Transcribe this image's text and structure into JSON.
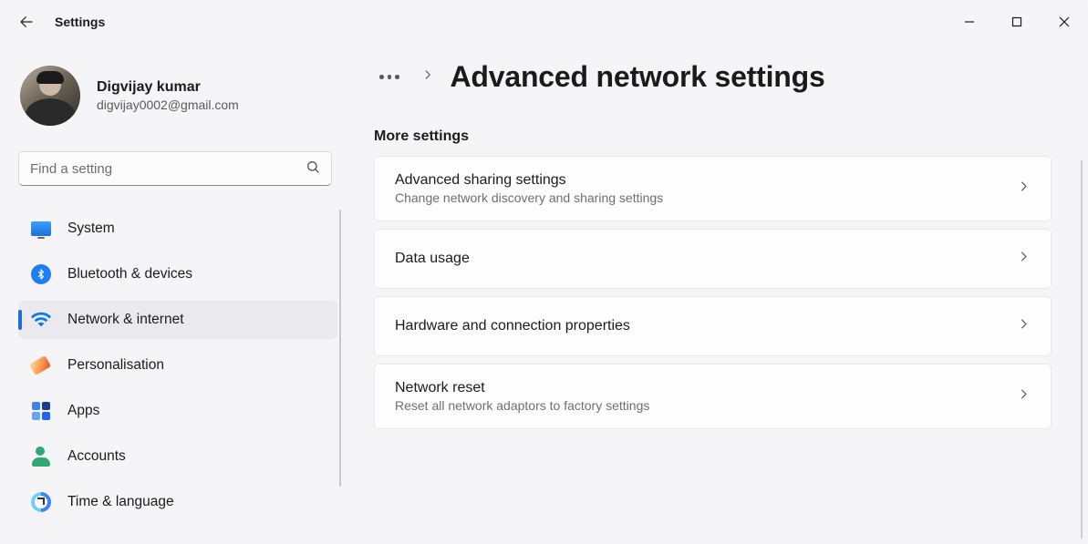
{
  "app_title": "Settings",
  "profile": {
    "name": "Digvijay kumar",
    "email": "digvijay0002@gmail.com"
  },
  "search": {
    "placeholder": "Find a setting"
  },
  "sidebar": {
    "items": [
      {
        "label": "System",
        "icon": "system-icon",
        "active": false
      },
      {
        "label": "Bluetooth & devices",
        "icon": "bluetooth-icon",
        "active": false
      },
      {
        "label": "Network & internet",
        "icon": "network-icon",
        "active": true
      },
      {
        "label": "Personalisation",
        "icon": "personalisation-icon",
        "active": false
      },
      {
        "label": "Apps",
        "icon": "apps-icon",
        "active": false
      },
      {
        "label": "Accounts",
        "icon": "accounts-icon",
        "active": false
      },
      {
        "label": "Time & language",
        "icon": "time-language-icon",
        "active": false
      }
    ]
  },
  "breadcrumb": {
    "page_title": "Advanced network settings"
  },
  "section_label": "More settings",
  "cards": [
    {
      "title": "Advanced sharing settings",
      "subtitle": "Change network discovery and sharing settings"
    },
    {
      "title": "Data usage",
      "subtitle": ""
    },
    {
      "title": "Hardware and connection properties",
      "subtitle": ""
    },
    {
      "title": "Network reset",
      "subtitle": "Reset all network adaptors to factory settings"
    }
  ]
}
